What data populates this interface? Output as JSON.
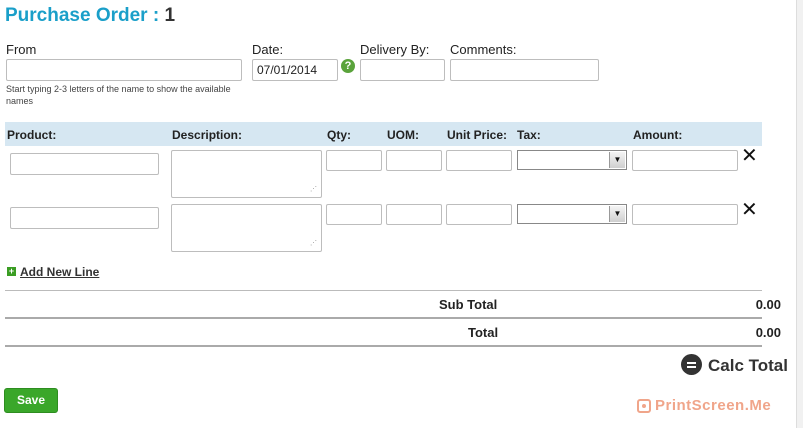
{
  "header": {
    "title": "Purchase Order :",
    "number": "1"
  },
  "form": {
    "from_label": "From",
    "from_value": "",
    "from_hint": "Start typing 2-3 letters of the name to show the available names",
    "date_label": "Date:",
    "date_value": "07/01/2014",
    "date_help_icon": "help-icon",
    "delivery_label": "Delivery By:",
    "delivery_value": "",
    "comments_label": "Comments:",
    "comments_value": ""
  },
  "grid": {
    "columns": [
      "Product:",
      "Description:",
      "Qty:",
      "UOM:",
      "Unit Price:",
      "Tax:",
      "Amount:"
    ],
    "rows": [
      {
        "product": "",
        "description": "",
        "qty": "",
        "uom": "",
        "unit_price": "",
        "tax": "",
        "amount": "",
        "delete_icon": "close-icon"
      },
      {
        "product": "",
        "description": "",
        "qty": "",
        "uom": "",
        "unit_price": "",
        "tax": "",
        "amount": "",
        "delete_icon": "close-icon"
      }
    ]
  },
  "actions": {
    "add_line_label": "Add New Line",
    "add_line_icon": "plus-icon",
    "calc_label": "Calc Total",
    "calc_icon": "equals-icon",
    "save_label": "Save"
  },
  "totals": {
    "subtotal_label": "Sub Total",
    "subtotal_value": "0.00",
    "total_label": "Total",
    "total_value": "0.00"
  },
  "watermark": {
    "text": "PrintScreen.Me"
  },
  "colors": {
    "title": "#1a9fc9",
    "grid_header": "#d6e7f2",
    "save_button": "#3aa72a",
    "add_icon": "#3a9d23",
    "watermark": "#f0a58a"
  }
}
